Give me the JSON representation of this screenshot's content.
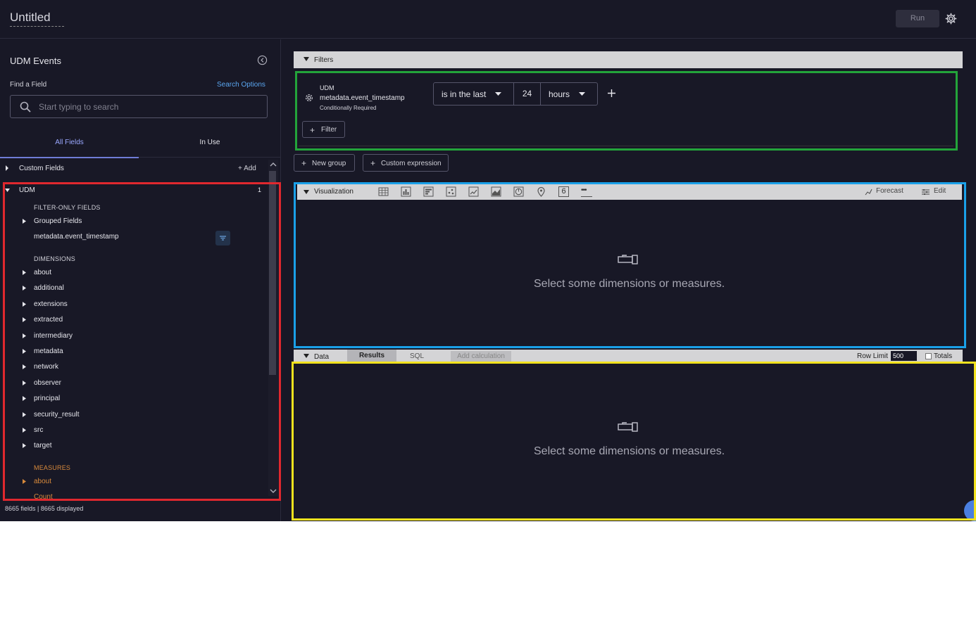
{
  "header": {
    "title": "Untitled",
    "run_label": "Run"
  },
  "left_panel": {
    "title": "UDM Events",
    "find_label": "Find a Field",
    "search_options": "Search Options",
    "search_placeholder": "Start typing to search",
    "tabs": {
      "all": "All Fields",
      "in_use": "In Use"
    },
    "custom_fields": {
      "label": "Custom Fields",
      "add": "Add"
    },
    "udm": {
      "label": "UDM",
      "count": "1"
    },
    "filter_only": {
      "heading": "FILTER-ONLY FIELDS",
      "grouped": "Grouped Fields",
      "timestamp": "metadata.event_timestamp"
    },
    "dimensions": {
      "heading": "DIMENSIONS",
      "items": [
        "about",
        "additional",
        "extensions",
        "extracted",
        "intermediary",
        "metadata",
        "network",
        "observer",
        "principal",
        "security_result",
        "src",
        "target"
      ]
    },
    "measures": {
      "heading": "MEASURES",
      "items": [
        "about",
        "Count"
      ]
    },
    "footer": "8665 fields | 8665 displayed"
  },
  "filters": {
    "bar_label": "Filters",
    "source": "UDM",
    "field": "metadata.event_timestamp",
    "requirement": "Conditionally Required",
    "operator": "is in the last",
    "value": "24",
    "unit": "hours",
    "add_filter": "Filter",
    "new_group": "New group",
    "custom_expression": "Custom expression"
  },
  "visualization": {
    "bar_label": "Visualization",
    "icons": [
      "table-icon",
      "column-chart-icon",
      "bar-chart-icon",
      "scatter-icon",
      "line-chart-icon",
      "area-chart-icon",
      "pie-chart-icon",
      "map-pin-icon",
      "single-value-icon",
      "more-icon"
    ],
    "single_value_glyph": "6",
    "more_glyph": "•••",
    "forecast": "Forecast",
    "edit": "Edit",
    "empty_message": "Select some dimensions or measures."
  },
  "data": {
    "bar_label": "Data",
    "tab_results": "Results",
    "tab_sql": "SQL",
    "add_calculation": "Add calculation",
    "row_limit_label": "Row Limit",
    "row_limit_value": "500",
    "totals": "Totals",
    "empty_message": "Select some dimensions or measures."
  },
  "colors": {
    "background": "#181826",
    "highlight_red": "#e0282e",
    "highlight_green": "#23a43a",
    "highlight_blue": "#1aa0e8",
    "highlight_yellow": "#f2e21e",
    "link_blue": "#5aa6f0",
    "measures_orange": "#d88a3c"
  }
}
